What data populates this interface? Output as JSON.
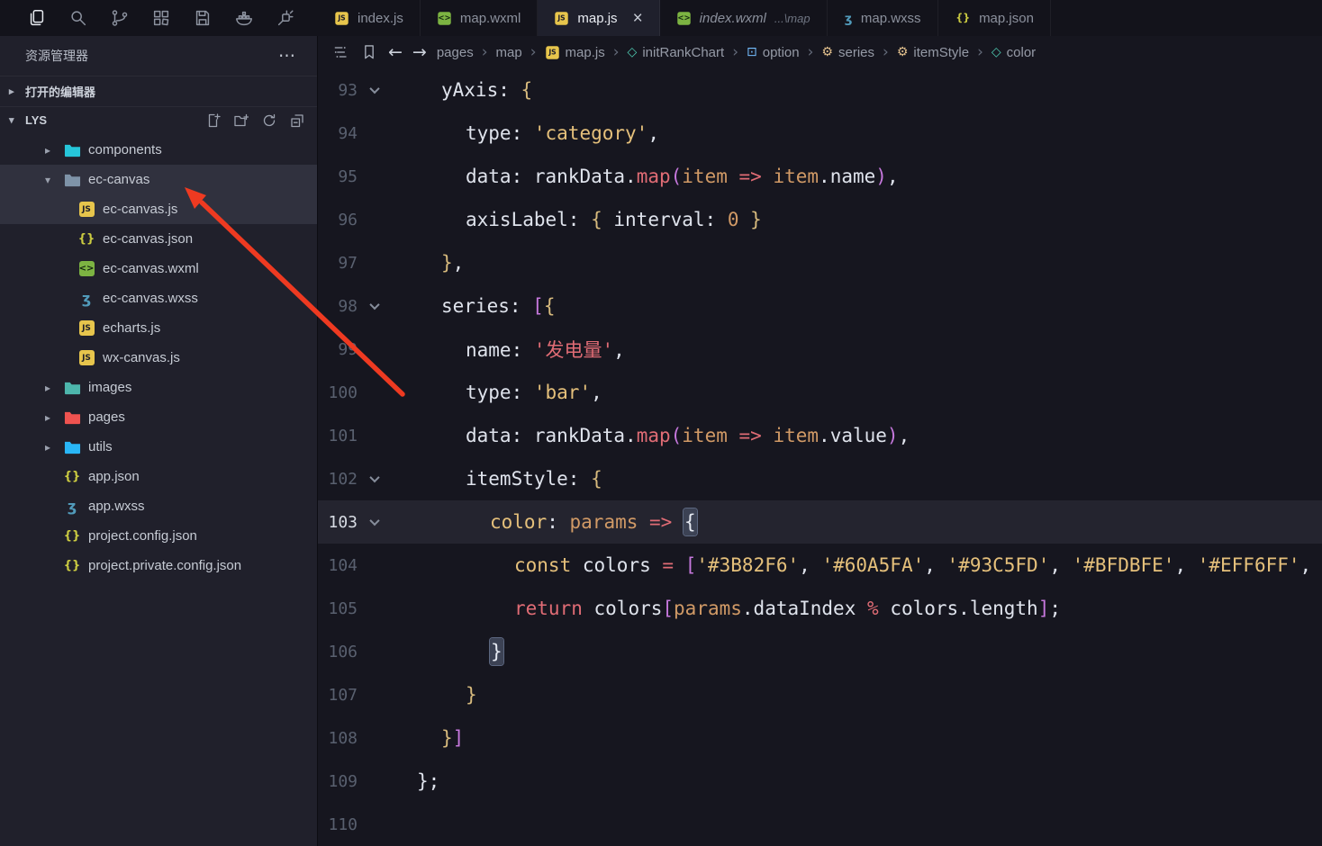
{
  "activity_bar": {
    "icons": [
      {
        "name": "files",
        "active": true
      },
      {
        "name": "search"
      },
      {
        "name": "source-control"
      },
      {
        "name": "extensions"
      },
      {
        "name": "save-all"
      },
      {
        "name": "docker"
      },
      {
        "name": "plugin"
      }
    ]
  },
  "tabs": [
    {
      "label": "index.js",
      "icon": "js"
    },
    {
      "label": "map.wxml",
      "icon": "wxml"
    },
    {
      "label": "map.js",
      "icon": "js",
      "active": true,
      "close_glyph": "×"
    },
    {
      "label": "index.wxml",
      "suffix": "...\\map",
      "icon": "wxml",
      "preview": true
    },
    {
      "label": "map.wxss",
      "icon": "wxss"
    },
    {
      "label": "map.json",
      "icon": "json"
    }
  ],
  "sidebar": {
    "title": "资源管理器",
    "menu_glyph": "⋯",
    "open_editors_label": "打开的编辑器",
    "workspace_label": "LYS",
    "actions": [
      "new-file",
      "new-folder",
      "refresh",
      "collapse-all"
    ],
    "tree": [
      {
        "label": "components",
        "icon": "folder",
        "color": "#26c6da",
        "level": 0,
        "chevron": "collapsed"
      },
      {
        "label": "ec-canvas",
        "icon": "folder",
        "color": "#7e93a8",
        "level": 0,
        "chevron": "expanded",
        "selected": true
      },
      {
        "label": "ec-canvas.js",
        "icon": "js",
        "level": 1,
        "selected": true
      },
      {
        "label": "ec-canvas.json",
        "icon": "json",
        "level": 1
      },
      {
        "label": "ec-canvas.wxml",
        "icon": "wxml",
        "level": 1
      },
      {
        "label": "ec-canvas.wxss",
        "icon": "wxss",
        "level": 1
      },
      {
        "label": "echarts.js",
        "icon": "js",
        "level": 1
      },
      {
        "label": "wx-canvas.js",
        "icon": "js",
        "level": 1
      },
      {
        "label": "images",
        "icon": "folder",
        "color": "#4db6ac",
        "level": 0,
        "chevron": "collapsed"
      },
      {
        "label": "pages",
        "icon": "folder",
        "color": "#ef5350",
        "level": 0,
        "chevron": "collapsed"
      },
      {
        "label": "utils",
        "icon": "folder",
        "color": "#29b6f6",
        "level": 0,
        "chevron": "collapsed"
      },
      {
        "label": "app.json",
        "icon": "json",
        "level": 0,
        "file": true
      },
      {
        "label": "app.wxss",
        "icon": "wxss",
        "level": 0,
        "file": true
      },
      {
        "label": "project.config.json",
        "icon": "json",
        "level": 0,
        "file": true
      },
      {
        "label": "project.private.config.json",
        "icon": "json",
        "level": 0,
        "file": true
      }
    ]
  },
  "breadcrumb": {
    "back_glyph": "←",
    "forward_glyph": "→",
    "items": [
      {
        "label": "pages"
      },
      {
        "label": "map"
      },
      {
        "label": "map.js",
        "icon": "js"
      },
      {
        "label": "initRankChart",
        "icon": "cube"
      },
      {
        "label": "option",
        "icon": "object"
      },
      {
        "label": "series",
        "icon": "gear"
      },
      {
        "label": "itemStyle",
        "icon": "gear"
      },
      {
        "label": "color",
        "icon": "cube"
      }
    ]
  },
  "editor": {
    "current_line": 103,
    "lines": [
      {
        "n": 93,
        "indent": 2,
        "fold": true,
        "tokens": [
          [
            "yAxis",
            "fg"
          ],
          [
            ": ",
            "fg"
          ],
          [
            "{",
            "b1"
          ]
        ]
      },
      {
        "n": 94,
        "indent": 3,
        "tokens": [
          [
            "type",
            "fg"
          ],
          [
            ": ",
            "fg"
          ],
          [
            "'category'",
            "str"
          ],
          [
            ",",
            "fg"
          ]
        ]
      },
      {
        "n": 95,
        "indent": 3,
        "tokens": [
          [
            "data",
            "fg"
          ],
          [
            ": ",
            "fg"
          ],
          [
            "rankData",
            "fg"
          ],
          [
            ".",
            "fg"
          ],
          [
            "map",
            "fn"
          ],
          [
            "(",
            "b2"
          ],
          [
            "item",
            "param"
          ],
          [
            " ",
            "fg"
          ],
          [
            "=>",
            "kw"
          ],
          [
            " ",
            "fg"
          ],
          [
            "item",
            "param"
          ],
          [
            ".",
            "fg"
          ],
          [
            "name",
            "fg"
          ],
          [
            ")",
            "b2"
          ],
          [
            ",",
            "fg"
          ]
        ]
      },
      {
        "n": 96,
        "indent": 3,
        "tokens": [
          [
            "axisLabel",
            "fg"
          ],
          [
            ": ",
            "fg"
          ],
          [
            "{ ",
            "b1"
          ],
          [
            "interval",
            "fg"
          ],
          [
            ": ",
            "fg"
          ],
          [
            "0",
            "num"
          ],
          [
            " }",
            "b1"
          ]
        ]
      },
      {
        "n": 97,
        "indent": 2,
        "tokens": [
          [
            "}",
            "b1"
          ],
          [
            ",",
            "fg"
          ]
        ]
      },
      {
        "n": 98,
        "indent": 2,
        "fold": true,
        "tokens": [
          [
            "series",
            "fg"
          ],
          [
            ": ",
            "fg"
          ],
          [
            "[",
            "b2"
          ],
          [
            "{",
            "b1"
          ]
        ]
      },
      {
        "n": 99,
        "indent": 3,
        "tokens": [
          [
            "name",
            "fg"
          ],
          [
            ": ",
            "fg"
          ],
          [
            "'发电量'",
            "strcn"
          ],
          [
            ",",
            "fg"
          ]
        ]
      },
      {
        "n": 100,
        "indent": 3,
        "tokens": [
          [
            "type",
            "fg"
          ],
          [
            ": ",
            "fg"
          ],
          [
            "'bar'",
            "str"
          ],
          [
            ",",
            "fg"
          ]
        ]
      },
      {
        "n": 101,
        "indent": 3,
        "tokens": [
          [
            "data",
            "fg"
          ],
          [
            ": ",
            "fg"
          ],
          [
            "rankData",
            "fg"
          ],
          [
            ".",
            "fg"
          ],
          [
            "map",
            "fn"
          ],
          [
            "(",
            "b2"
          ],
          [
            "item",
            "param"
          ],
          [
            " ",
            "fg"
          ],
          [
            "=>",
            "kw"
          ],
          [
            " ",
            "fg"
          ],
          [
            "item",
            "param"
          ],
          [
            ".",
            "fg"
          ],
          [
            "value",
            "fg"
          ],
          [
            ")",
            "b2"
          ],
          [
            ",",
            "fg"
          ]
        ]
      },
      {
        "n": 102,
        "indent": 3,
        "fold": true,
        "tokens": [
          [
            "itemStyle",
            "fg"
          ],
          [
            ": ",
            "fg"
          ],
          [
            "{",
            "b1"
          ]
        ]
      },
      {
        "n": 103,
        "indent": 4,
        "fold": true,
        "current": true,
        "tokens": [
          [
            "color",
            "str"
          ],
          [
            ": ",
            "fg"
          ],
          [
            "params",
            "param"
          ],
          [
            " ",
            "fg"
          ],
          [
            "=>",
            "kw"
          ],
          [
            " ",
            "fg"
          ],
          [
            "{",
            "boxed"
          ]
        ]
      },
      {
        "n": 104,
        "indent": 5,
        "tokens": [
          [
            "const",
            "kw2"
          ],
          [
            " ",
            "fg"
          ],
          [
            "colors",
            "fg"
          ],
          [
            " ",
            "fg"
          ],
          [
            "=",
            "kw"
          ],
          [
            " ",
            "fg"
          ],
          [
            "[",
            "b2"
          ],
          [
            "'#3B82F6'",
            "str"
          ],
          [
            ", ",
            "fg"
          ],
          [
            "'#60A5FA'",
            "str"
          ],
          [
            ", ",
            "fg"
          ],
          [
            "'#93C5FD'",
            "str"
          ],
          [
            ", ",
            "fg"
          ],
          [
            "'#BFDBFE'",
            "str"
          ],
          [
            ", ",
            "fg"
          ],
          [
            "'#EFF6FF'",
            "str"
          ],
          [
            ",",
            "fg"
          ]
        ]
      },
      {
        "n": 105,
        "indent": 5,
        "tokens": [
          [
            "return",
            "kw"
          ],
          [
            " ",
            "fg"
          ],
          [
            "colors",
            "fg"
          ],
          [
            "[",
            "b2"
          ],
          [
            "params",
            "param"
          ],
          [
            ".",
            "fg"
          ],
          [
            "dataIndex",
            "fg"
          ],
          [
            " ",
            "fg"
          ],
          [
            "%",
            "kw"
          ],
          [
            " ",
            "fg"
          ],
          [
            "colors",
            "fg"
          ],
          [
            ".",
            "fg"
          ],
          [
            "length",
            "fg"
          ],
          [
            "]",
            "b2"
          ],
          [
            ";",
            "fg"
          ]
        ]
      },
      {
        "n": 106,
        "indent": 4,
        "tokens": [
          [
            "}",
            "boxed"
          ]
        ]
      },
      {
        "n": 107,
        "indent": 3,
        "tokens": [
          [
            "}",
            "b1"
          ]
        ]
      },
      {
        "n": 108,
        "indent": 2,
        "tokens": [
          [
            "}",
            "b1"
          ],
          [
            "]",
            "b2"
          ]
        ]
      },
      {
        "n": 109,
        "indent": 1,
        "tokens": [
          [
            "}",
            "fg"
          ],
          [
            ";",
            "fg"
          ]
        ]
      },
      {
        "n": 110,
        "indent": 0,
        "tokens": []
      }
    ]
  },
  "annotation": {
    "arrow_color": "#ee3a21"
  },
  "colors": {
    "string": "#e5c07b",
    "keyword": "#e06c75",
    "param": "#d19a66",
    "accent_series": "#3B82F6"
  }
}
